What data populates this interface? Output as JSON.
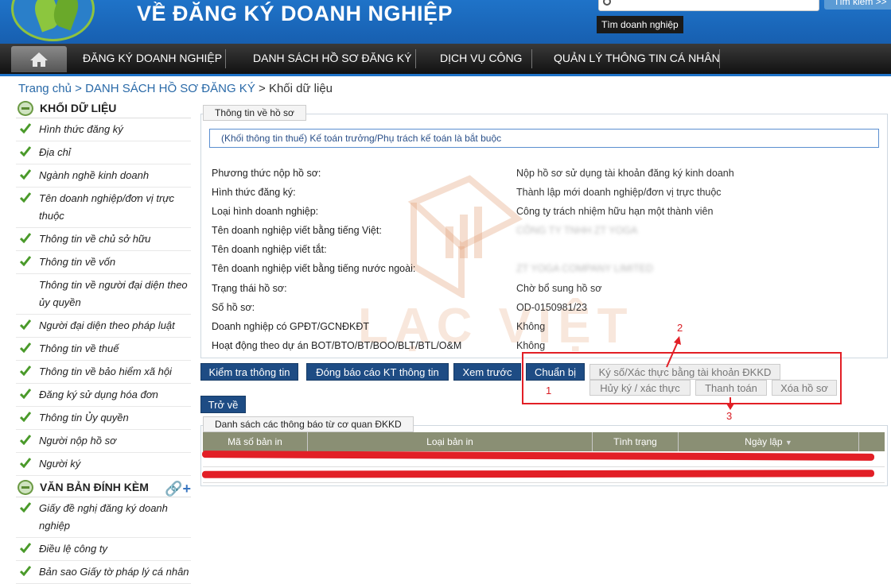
{
  "header": {
    "title": "VỀ ĐĂNG KÝ DOANH NGHIỆP",
    "search_button": "Tìm kiếm >>",
    "search_tooltip": "Tìm doanh nghiệp"
  },
  "nav": {
    "items": [
      "ĐĂNG KÝ DOANH NGHIỆP",
      "DANH SÁCH HỒ SƠ ĐĂNG KÝ",
      "DỊCH VỤ CÔNG",
      "QUẢN LÝ THÔNG TIN CÁ NHÂN"
    ]
  },
  "breadcrumb": {
    "home": "Trang chủ",
    "sep": " > ",
    "list": "DANH SÁCH HỒ SƠ ĐĂNG KÝ",
    "current": "Khối dữ liệu"
  },
  "sidebar": {
    "section1": "KHỐI DỮ LIỆU",
    "items1": [
      "Hình thức đăng ký",
      "Địa chỉ",
      "Ngành nghề kinh doanh",
      "Tên doanh nghiệp/đơn vị trực thuộc",
      "Thông tin về chủ sở hữu",
      "Thông tin về vốn",
      "Thông tin về người đại diện theo ủy quyền",
      "Người đại diện theo pháp luật",
      "Thông tin về thuế",
      "Thông tin về bảo hiểm xã hội",
      "Đăng ký sử dụng hóa đơn",
      "Thông tin Ủy quyền",
      "Người nộp hồ sơ",
      "Người ký"
    ],
    "section2": "VĂN BẢN ĐÍNH KÈM",
    "items2": [
      "Giấy đề nghị đăng ký doanh nghiệp",
      "Điều lệ công ty",
      "Bản sao Giấy tờ pháp lý cá nhân"
    ]
  },
  "panel": {
    "tab": "Thông tin về hồ sơ",
    "note": "(Khối thông tin thuế) Kế toán trưởng/Phụ trách kế toán là bắt buộc",
    "rows": [
      {
        "label": "Phương thức nộp hồ sơ:",
        "value": "Nộp hồ sơ sử dụng tài khoản đăng ký kinh doanh"
      },
      {
        "label": "Hình thức đăng ký:",
        "value": "Thành lập mới doanh nghiệp/đơn vị trực thuộc"
      },
      {
        "label": "Loại hình doanh nghiệp:",
        "value": "Công ty trách nhiệm hữu hạn một thành viên"
      },
      {
        "label": "Tên doanh nghiệp viết bằng tiếng Việt:",
        "value": "CÔNG TY TNHH ZT YOGA"
      },
      {
        "label": "Tên doanh nghiệp viết tắt:",
        "value": ""
      },
      {
        "label": "Tên doanh nghiệp viết bằng tiếng nước ngoài:",
        "value": "ZT YOGA COMPANY LIMITED"
      },
      {
        "label": "Trạng thái hồ sơ:",
        "value": "Chờ bổ sung hồ sơ"
      },
      {
        "label": "Số hồ sơ:",
        "value": "OD-0150981/23"
      },
      {
        "label": "Doanh nghiệp có GPĐT/GCNĐKĐT",
        "value": "Không"
      },
      {
        "label": "Hoạt động theo dự án BOT/BTO/BT/BOO/BLT/BTL/O&M",
        "value": "Không"
      }
    ]
  },
  "watermark": "LẠC VIỆT",
  "buttons": {
    "check": "Kiểm tra thông tin",
    "report": "Đóng báo cáo KT thông tin",
    "preview": "Xem trước",
    "prepare": "Chuẩn bị",
    "sign_account": "Ký số/Xác thực bằng tài khoản ĐKKD",
    "cancel_sign": "Hủy ký / xác thực",
    "payment": "Thanh toán",
    "delete": "Xóa hồ sơ",
    "back": "Trở về"
  },
  "annotations": {
    "one": "1",
    "two": "2",
    "three": "3"
  },
  "notices": {
    "tab": "Danh sách các thông báo từ cơ quan ĐKKD",
    "columns": [
      "Mã số bản in",
      "Loại bản in",
      "Tình trạng",
      "Ngày lập"
    ]
  },
  "colors": {
    "header_blue": "#1d70c5",
    "button_navy": "#1e4c84",
    "annotation_red": "#e21f26",
    "table_header": "#8a8f74"
  }
}
